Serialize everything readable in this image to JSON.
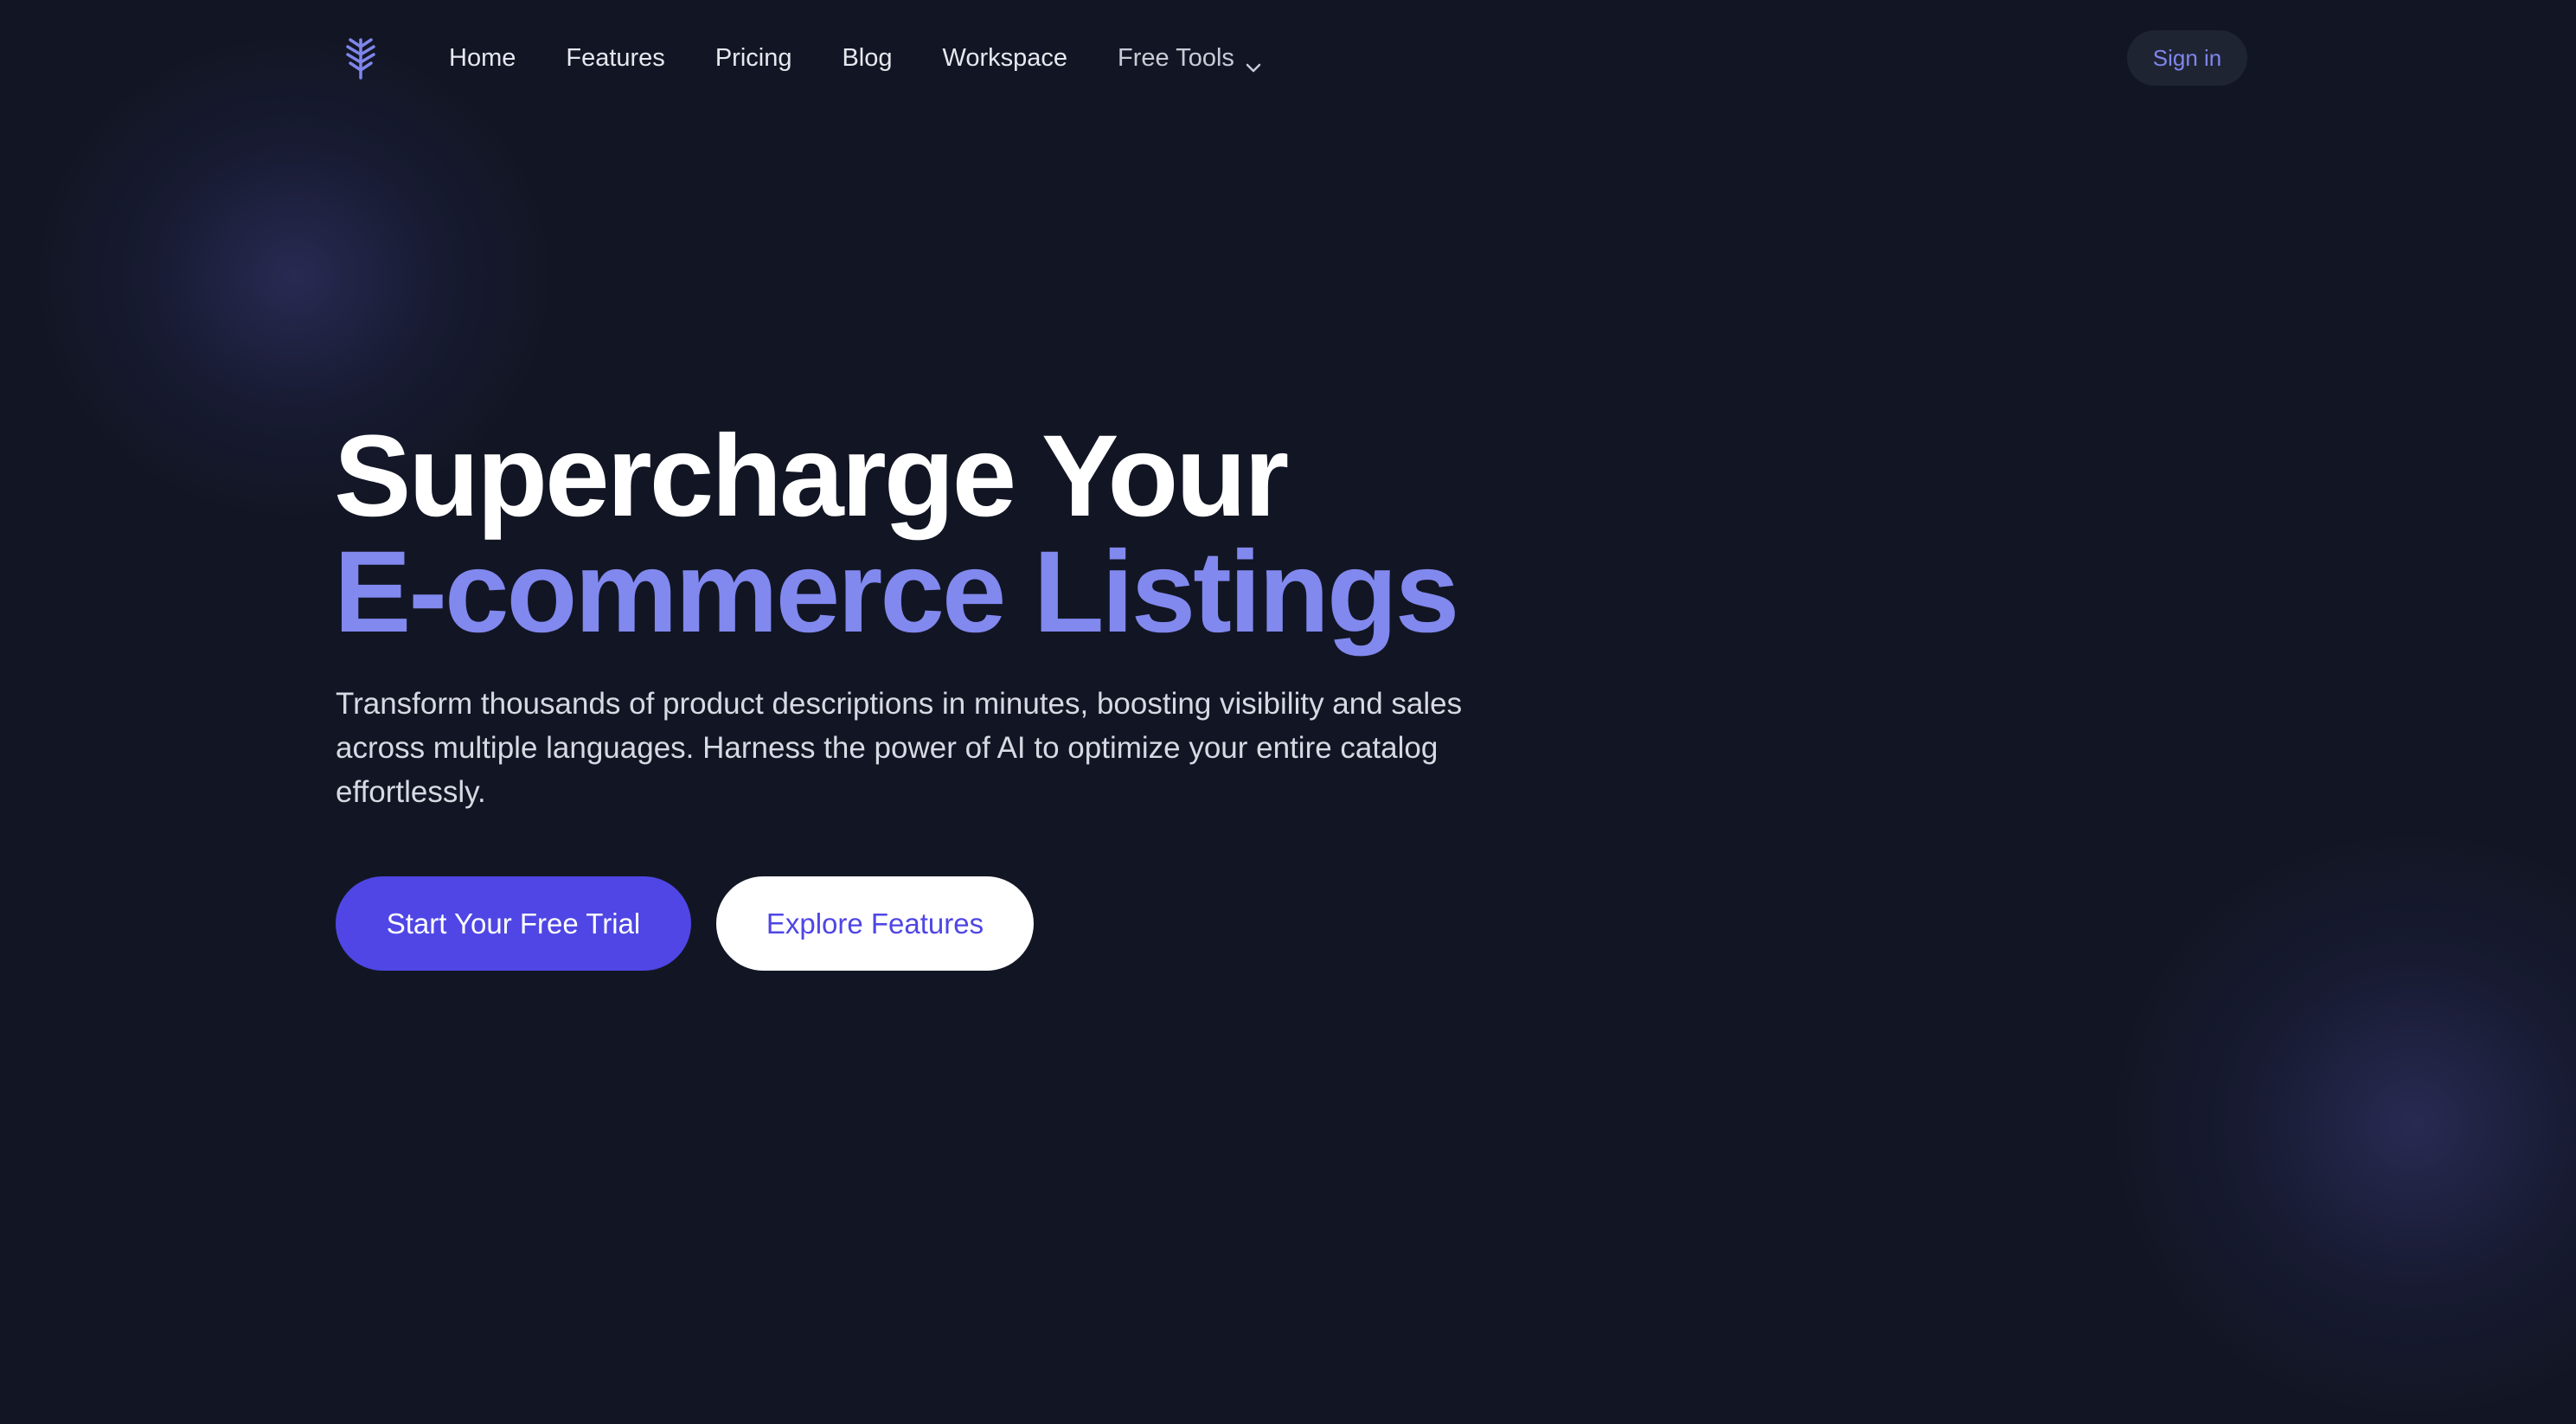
{
  "nav": {
    "logo_icon": "tree-logo-icon",
    "links": [
      "Home",
      "Features",
      "Pricing",
      "Blog",
      "Workspace"
    ],
    "dropdown": {
      "label": "Free Tools",
      "icon": "chevron-down-icon"
    },
    "signin_label": "Sign in"
  },
  "hero": {
    "title_line1": "Supercharge Your",
    "title_line2": "E-commerce Listings",
    "subtitle": "Transform thousands of product descriptions in minutes, boosting visibility and sales across multiple languages. Harness the power of AI to optimize your entire catalog effortlessly.",
    "primary_cta": "Start Your Free Trial",
    "secondary_cta": "Explore Features"
  },
  "colors": {
    "background": "#121624",
    "accent": "#4f46e5",
    "accent_light": "#8188ee",
    "signin_bg": "#1f2433"
  }
}
